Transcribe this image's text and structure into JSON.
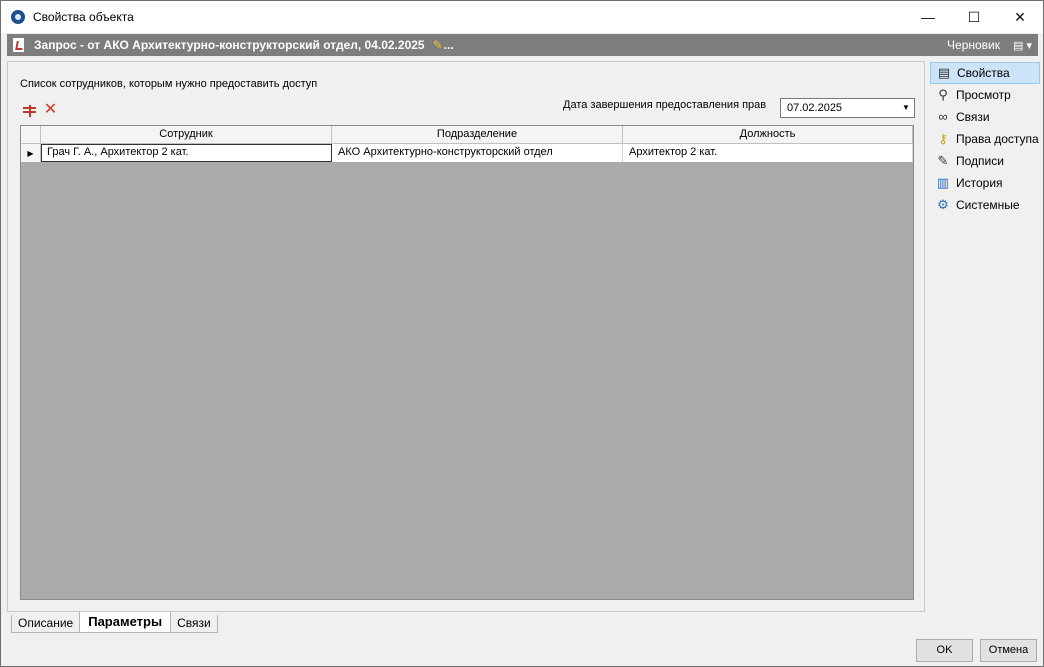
{
  "window": {
    "title": "Свойства объекта",
    "controls": {
      "minimize": "—",
      "maximize": "☐",
      "close": "✕"
    }
  },
  "docbar": {
    "title": "Запрос - от АКО Архитектурно-конструкторский отдел, 04.02.2025",
    "ellipsis": "...",
    "status": "Черновик"
  },
  "panel": {
    "label": "Список сотрудников, которым нужно предоставить доступ",
    "date_label": "Дата завершения предоставления прав",
    "date_value": "07.02.2025"
  },
  "grid": {
    "columns": [
      "Сотрудник",
      "Подразделение",
      "Должность"
    ],
    "rows": [
      [
        "Грач Г. А., Архитектор 2 кат.",
        "АКО Архитектурно-конструкторский отдел",
        "Архитектор 2 кат."
      ]
    ]
  },
  "tabs": [
    "Описание",
    "Параметры",
    "Связи"
  ],
  "sidebar": {
    "items": [
      {
        "label": "Свойства",
        "icon": "properties-icon"
      },
      {
        "label": "Просмотр",
        "icon": "magnifier-icon"
      },
      {
        "label": "Связи",
        "icon": "link-icon"
      },
      {
        "label": "Права доступа",
        "icon": "keys-icon"
      },
      {
        "label": "Подписи",
        "icon": "pen-icon"
      },
      {
        "label": "История",
        "icon": "history-icon"
      },
      {
        "label": "Системные",
        "icon": "system-icon"
      }
    ]
  },
  "buttons": {
    "ok": "OK",
    "cancel": "Отмена"
  }
}
